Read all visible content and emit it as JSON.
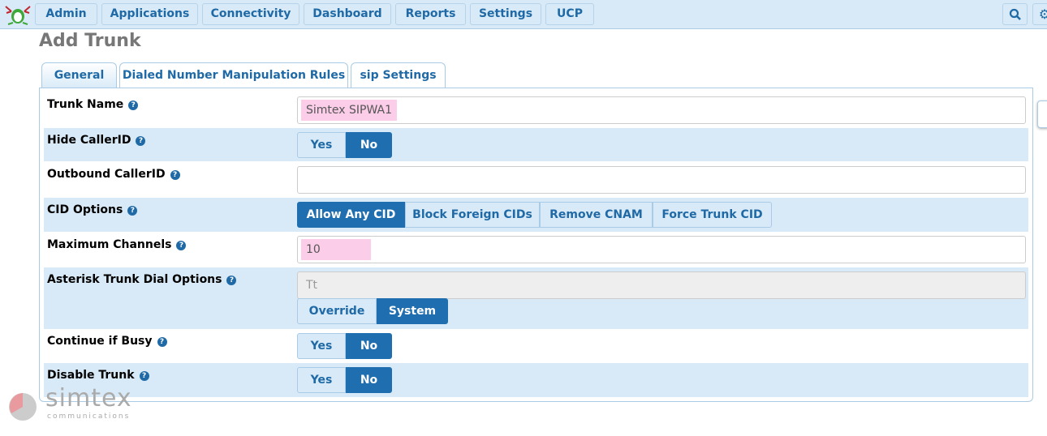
{
  "nav": {
    "items": [
      "Admin",
      "Applications",
      "Connectivity",
      "Dashboard",
      "Reports",
      "Settings",
      "UCP"
    ],
    "search_icon": "search-icon",
    "settings_icon": "gear-icon"
  },
  "page": {
    "title": "Add Trunk"
  },
  "tabs": [
    "General",
    "Dialed Number Manipulation Rules",
    "sip Settings"
  ],
  "active_tab": "General",
  "form": {
    "trunk_name": {
      "label": "Trunk Name",
      "value": "Simtex SIPWA1"
    },
    "hide_callerid": {
      "label": "Hide CallerID",
      "options": [
        "Yes",
        "No"
      ],
      "selected": "No"
    },
    "outbound_callerid": {
      "label": "Outbound CallerID",
      "value": ""
    },
    "cid_options": {
      "label": "CID Options",
      "options": [
        "Allow Any CID",
        "Block Foreign CIDs",
        "Remove CNAM",
        "Force Trunk CID"
      ],
      "selected": "Allow Any CID"
    },
    "max_channels": {
      "label": "Maximum Channels",
      "value": "10"
    },
    "dial_options": {
      "label": "Asterisk Trunk Dial Options",
      "value": "Tt",
      "options": [
        "Override",
        "System"
      ],
      "selected": "System"
    },
    "continue_busy": {
      "label": "Continue if Busy",
      "options": [
        "Yes",
        "No"
      ],
      "selected": "No"
    },
    "disable_trunk": {
      "label": "Disable Trunk",
      "options": [
        "Yes",
        "No"
      ],
      "selected": "No"
    }
  },
  "brand": {
    "name": "simtex",
    "tagline": "communications"
  },
  "colors": {
    "accent": "#1f6fb0",
    "row_alt": "#d8eaf7",
    "highlight": "#fccde9"
  }
}
